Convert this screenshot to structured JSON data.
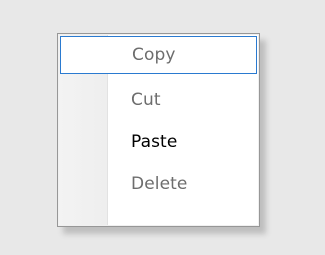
{
  "context_menu": {
    "items": [
      {
        "label": "Copy",
        "state": "focused-disabled"
      },
      {
        "label": "Cut",
        "state": "disabled"
      },
      {
        "label": "Paste",
        "state": "enabled"
      },
      {
        "label": "Delete",
        "state": "disabled"
      }
    ]
  },
  "colors": {
    "background": "#e8e8e8",
    "menu_border": "#979797",
    "focus_border": "#2a7ad0",
    "enabled_text": "#000000",
    "disabled_text": "#6d6d6d"
  }
}
